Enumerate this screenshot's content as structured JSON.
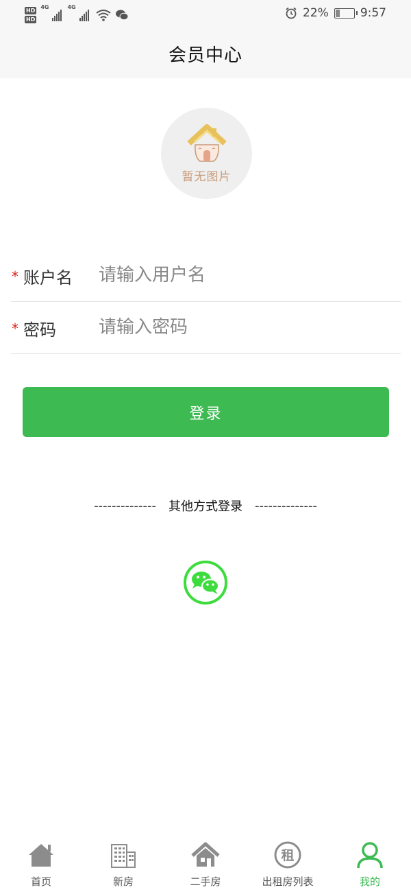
{
  "status_bar": {
    "hd1": "HD",
    "hd2": "HD",
    "net1": "4G",
    "net2": "4G",
    "battery_percent": "22%",
    "battery_level": 0.22,
    "time": "9:57"
  },
  "header": {
    "title": "会员中心"
  },
  "avatar": {
    "placeholder_text": "暂无图片"
  },
  "form": {
    "username": {
      "required_mark": "*",
      "label": "账户名",
      "placeholder": "请输入用户名",
      "value": ""
    },
    "password": {
      "required_mark": "*",
      "label": "密码",
      "placeholder": "请输入密码",
      "value": ""
    }
  },
  "login_button": {
    "label": "登录"
  },
  "other_login": {
    "dash_left": "--------------",
    "text": "其他方式登录",
    "dash_right": "--------------",
    "option_icon": "wechat-icon"
  },
  "colors": {
    "accent": "#3dba52",
    "required": "#d9251d",
    "header_bg": "#f7f7f7"
  },
  "tabbar": {
    "items": [
      {
        "label": "首页",
        "icon": "home-icon",
        "active": false
      },
      {
        "label": "新房",
        "icon": "building-icon",
        "active": false
      },
      {
        "label": "二手房",
        "icon": "house-icon",
        "active": false
      },
      {
        "label": "出租房列表",
        "icon": "rent-icon",
        "icon_text": "租",
        "active": false
      },
      {
        "label": "我的",
        "icon": "user-icon",
        "active": true
      }
    ]
  }
}
